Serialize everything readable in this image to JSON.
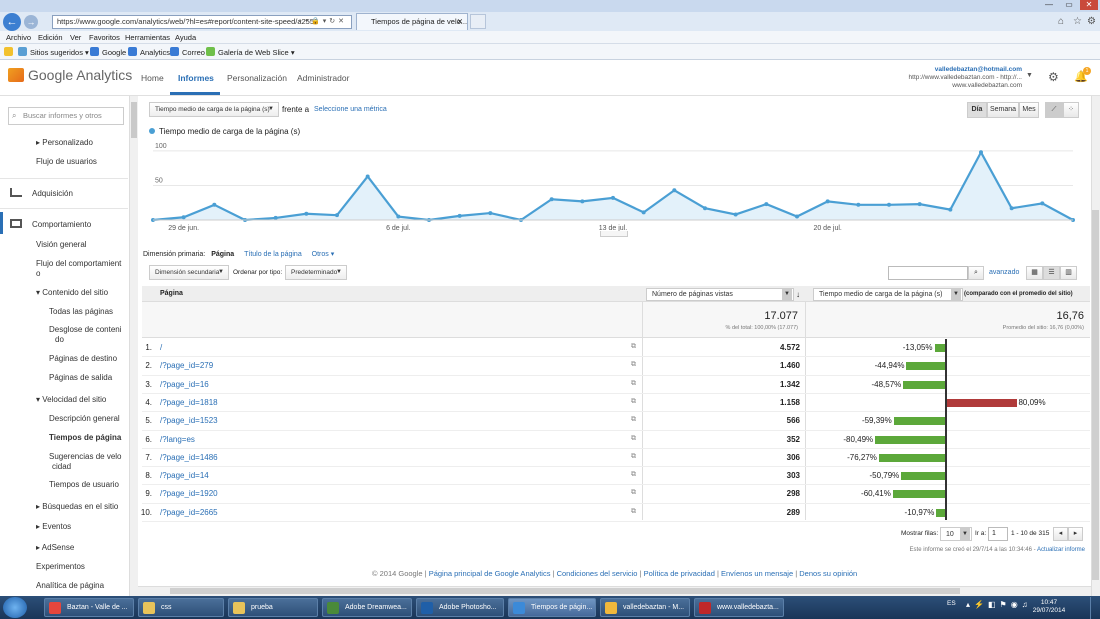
{
  "browser": {
    "url": "https://www.google.com/analytics/web/?hl=es#report/content-site-speed/a2558",
    "tab_title": "Tiempos de página de velo...",
    "menu": [
      "Archivo",
      "Edición",
      "Ver",
      "Favoritos",
      "Herramientas",
      "Ayuda"
    ],
    "favorites": [
      "Sitios sugeridos",
      "Google",
      "Analytics",
      "Correo",
      "Galería de Web Slice"
    ]
  },
  "ga": {
    "logo_text": "Google Analytics",
    "nav": [
      "Home",
      "Informes",
      "Personalización",
      "Administrador"
    ],
    "account_email": "valledebaztan@hotmail.com",
    "account_url": "http://www.valledebaztan.com - http://...",
    "account_site": "www.valledebaztan.com",
    "notification_count": "1"
  },
  "sidebar": {
    "search_placeholder": "Buscar informes y otros",
    "personalizado": "Personalizado",
    "flujo_usuarios": "Flujo de usuarios",
    "adquisicion": "Adquisición",
    "comportamiento": "Comportamiento",
    "vision_general": "Visión general",
    "flujo_comp_1": "Flujo del comportamient",
    "flujo_comp_2": "o",
    "contenido_sitio": "Contenido del sitio",
    "todas_paginas": "Todas las páginas",
    "desglose_1": "Desglose de conteni",
    "desglose_2": "do",
    "paginas_destino": "Páginas de destino",
    "paginas_salida": "Páginas de salida",
    "velocidad_sitio": "Velocidad del sitio",
    "descripcion_general": "Descripción general",
    "tiempos_pagina": "Tiempos de página",
    "sugerencias_1": "Sugerencias de velo",
    "sugerencias_2": "cidad",
    "tiempos_usuario": "Tiempos de usuario",
    "busquedas": "Búsquedas en el sitio",
    "eventos": "Eventos",
    "adsense": "AdSense",
    "experimentos": "Experimentos",
    "analitica_pagina": "Analítica de página"
  },
  "controls": {
    "metric_select": "Tiempo medio de carga de la página (s)",
    "versus": "frente a",
    "select_metric": "Seleccione una métrica",
    "period_day": "Día",
    "period_week": "Semana",
    "period_month": "Mes",
    "primary_dim_label": "Dimensión primaria:",
    "primary_dim_page": "Página",
    "primary_dim_title": "Título de la página",
    "primary_dim_other": "Otros",
    "secondary_dim": "Dimensión secundaria",
    "sort_label": "Ordenar por tipo:",
    "sort_value": "Predeterminado",
    "advanced": "avanzado"
  },
  "chart_data": {
    "type": "area",
    "legend": "Tiempo medio de carga de la página (s)",
    "y_ticks": [
      50,
      100
    ],
    "ylim": [
      0,
      110
    ],
    "x_labels": [
      "29 de jun.",
      "6 de jul.",
      "13 de jul.",
      "20 de jul."
    ],
    "x_label_index": [
      1,
      8,
      15,
      22
    ],
    "values": [
      0,
      4,
      22,
      0,
      3,
      9,
      7,
      63,
      5,
      0,
      6,
      10,
      0,
      30,
      27,
      32,
      11,
      43,
      17,
      8,
      23,
      5,
      27,
      22,
      22,
      23,
      15,
      98,
      17,
      24,
      0
    ],
    "color": "#4a9fd4"
  },
  "table": {
    "col_page": "Página",
    "col_views": "Número de páginas vistas",
    "col_time": "Tiempo medio de carga de la página (s)",
    "col_time_note": "(comparado con el promedio del sitio)",
    "total_views": "17.077",
    "total_views_sub": "% del total: 100,00% (17.077)",
    "total_time": "16,76",
    "total_time_sub": "Promedio del sitio: 16,76 (0,00%)",
    "rows": [
      {
        "n": "1.",
        "page": "/",
        "views": "4.572",
        "pct": "-13,05%",
        "delta": -13.05
      },
      {
        "n": "2.",
        "page": "/?page_id=279",
        "views": "1.460",
        "pct": "-44,94%",
        "delta": -44.94
      },
      {
        "n": "3.",
        "page": "/?page_id=16",
        "views": "1.342",
        "pct": "-48,57%",
        "delta": -48.57
      },
      {
        "n": "4.",
        "page": "/?page_id=1818",
        "views": "1.158",
        "pct": "80,09%",
        "delta": 80.09
      },
      {
        "n": "5.",
        "page": "/?page_id=1523",
        "views": "566",
        "pct": "-59,39%",
        "delta": -59.39
      },
      {
        "n": "6.",
        "page": "/?lang=es",
        "views": "352",
        "pct": "-80,49%",
        "delta": -80.49
      },
      {
        "n": "7.",
        "page": "/?page_id=1486",
        "views": "306",
        "pct": "-76,27%",
        "delta": -76.27
      },
      {
        "n": "8.",
        "page": "/?page_id=14",
        "views": "303",
        "pct": "-50,79%",
        "delta": -50.79
      },
      {
        "n": "9.",
        "page": "/?page_id=1920",
        "views": "298",
        "pct": "-60,41%",
        "delta": -60.41
      },
      {
        "n": "10.",
        "page": "/?page_id=2665",
        "views": "289",
        "pct": "-10,97%",
        "delta": -10.97
      }
    ]
  },
  "pagination": {
    "show_rows_label": "Mostrar filas:",
    "show_rows_value": "10",
    "goto_label": "Ir a:",
    "goto_value": "1",
    "range": "1 - 10 de 315"
  },
  "footer": {
    "created": "Este informe se creó el 29/7/14 a las 10:34:46 -",
    "update": "Actualizar informe",
    "copyright": "© 2014 Google",
    "links": [
      "Página principal de Google Analytics",
      "Condiciones del servicio",
      "Política de privacidad",
      "Envíenos un mensaje",
      "Denos su opinión"
    ]
  },
  "taskbar": {
    "items": [
      {
        "label": "Baztan - Valle de ...",
        "color": "#e6463c"
      },
      {
        "label": "css",
        "color": "#e8c35a"
      },
      {
        "label": "prueba",
        "color": "#e8c35a"
      },
      {
        "label": "Adobe Dreamwea...",
        "color": "#4a8a3a"
      },
      {
        "label": "Adobe Photosho...",
        "color": "#1f5fa8"
      },
      {
        "label": "Tiempos de págin...",
        "color": "#3c8ad8"
      },
      {
        "label": "valledebaztan - M...",
        "color": "#f0b83c"
      },
      {
        "label": "www.valledebazta...",
        "color": "#c0282a"
      }
    ],
    "lang": "ES",
    "time": "10:47",
    "date": "29/07/2014"
  }
}
